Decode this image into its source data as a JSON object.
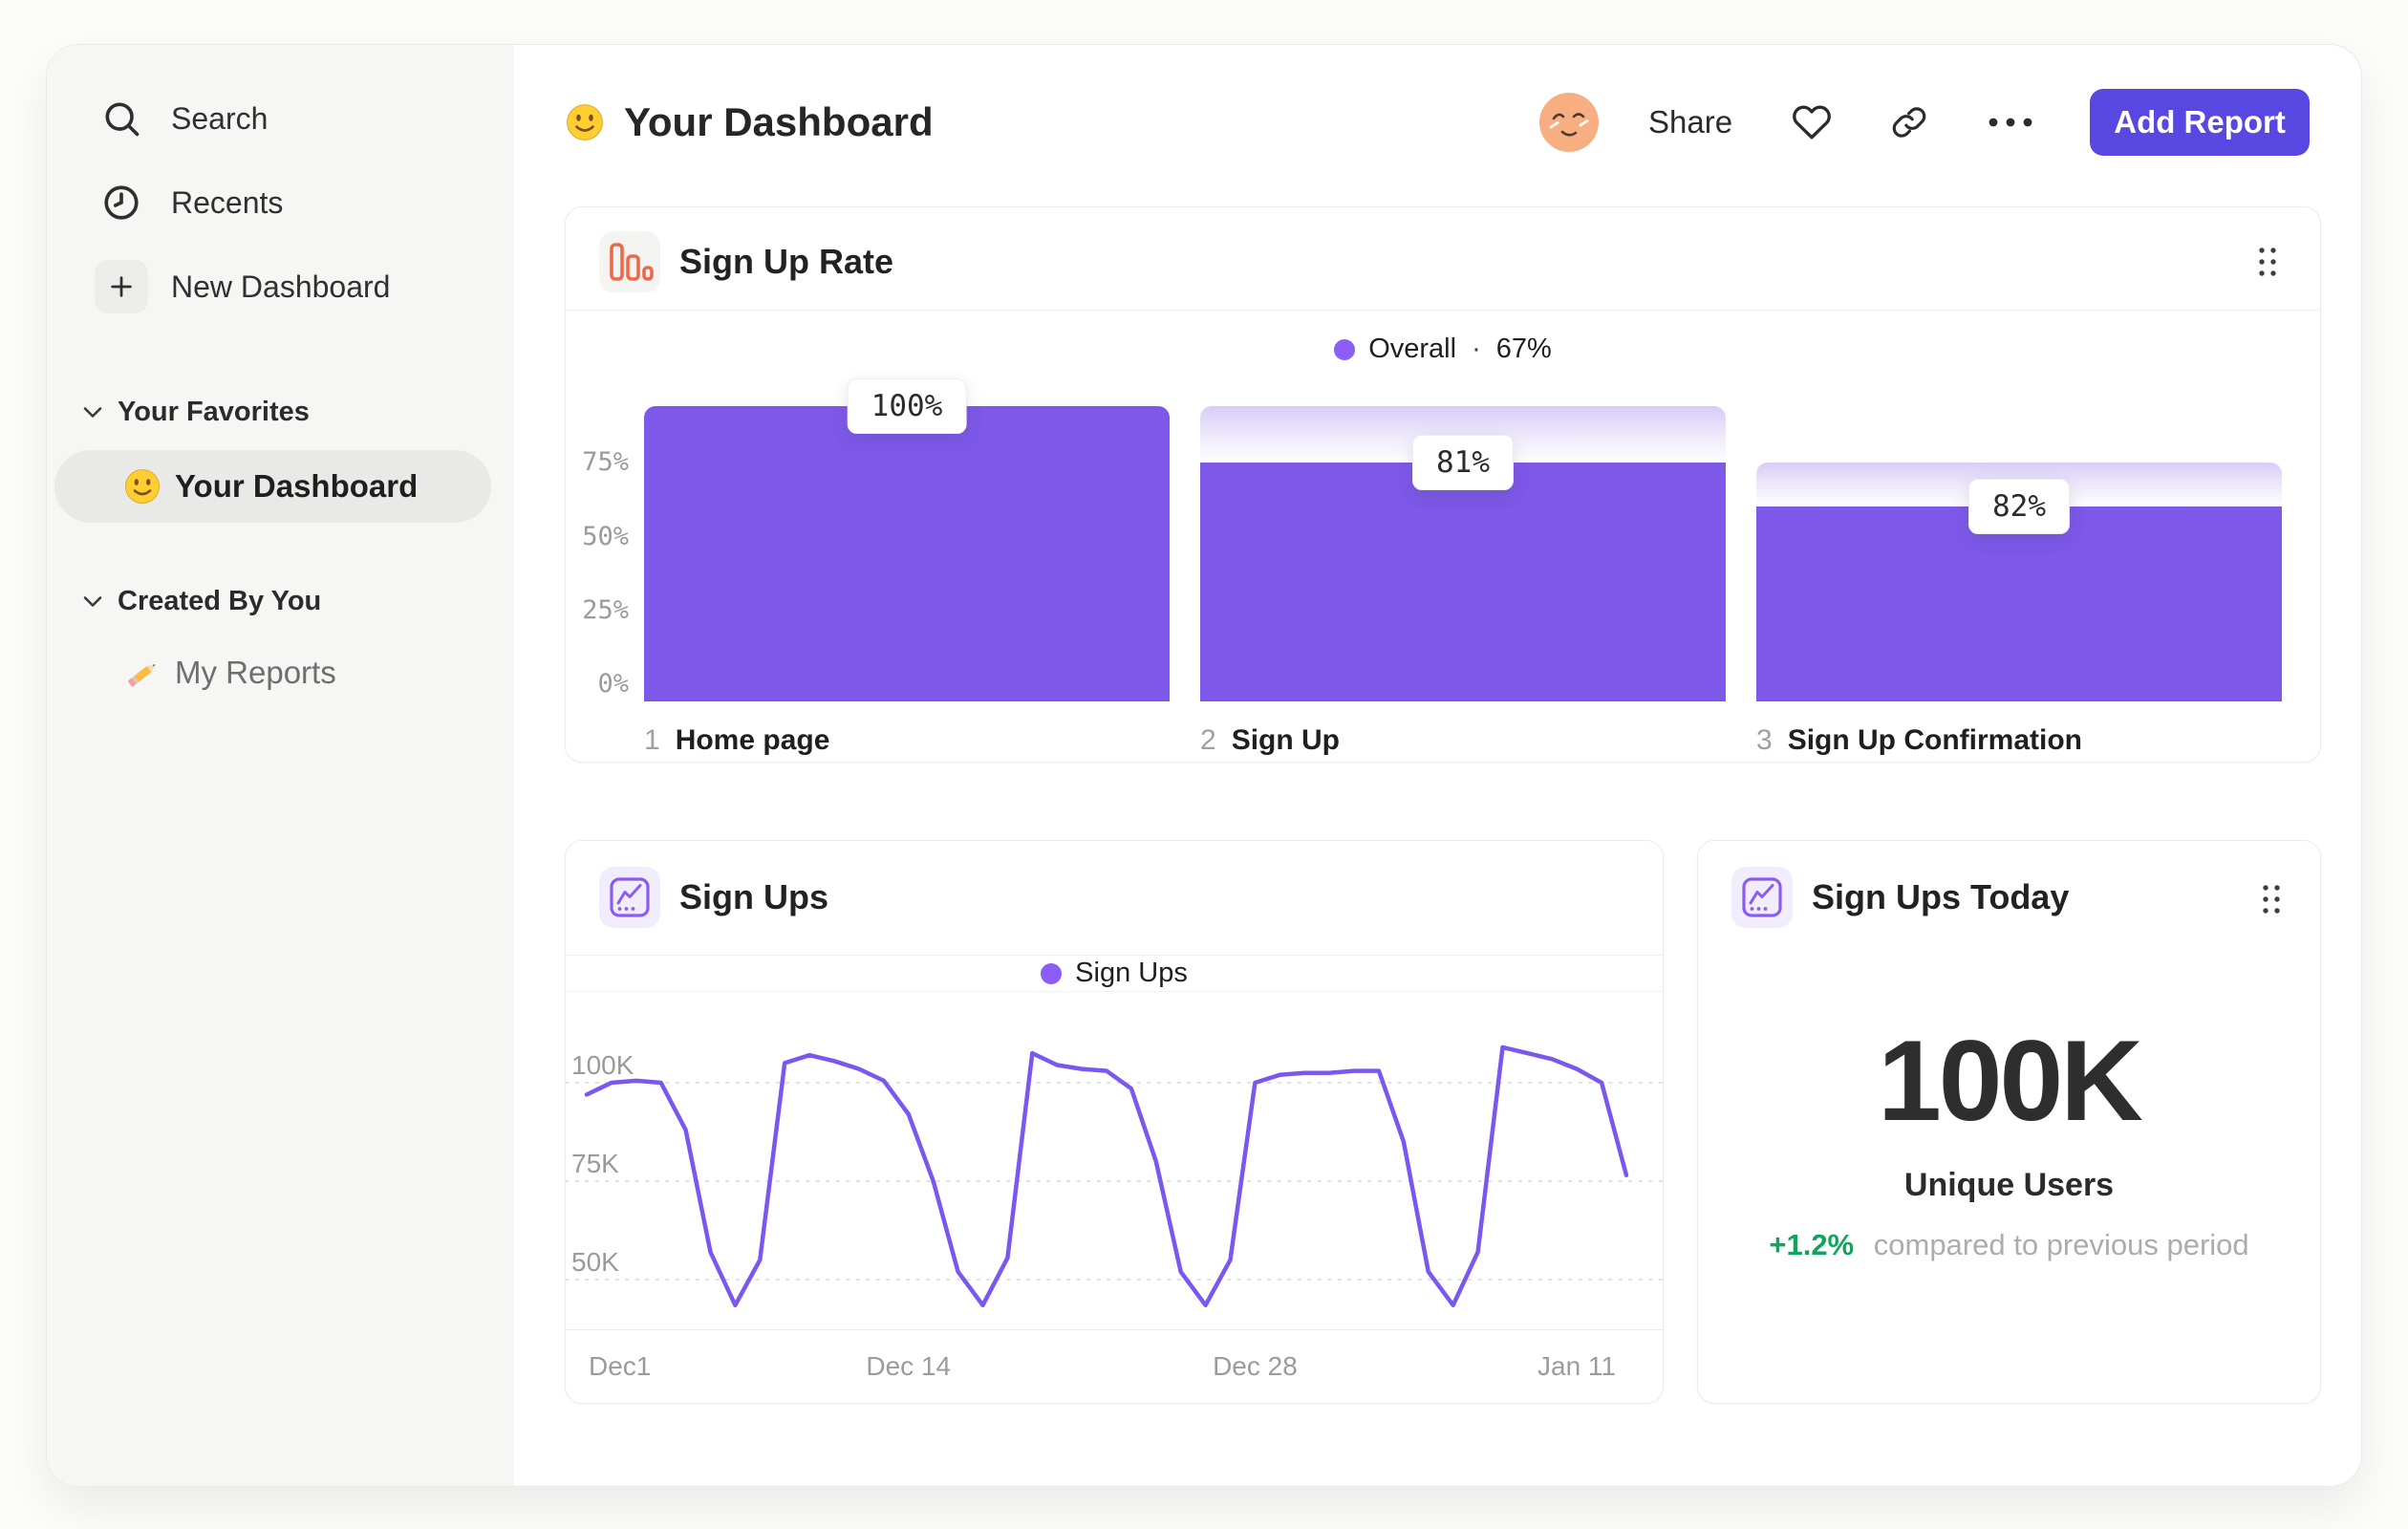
{
  "sidebar": {
    "nav": [
      {
        "label": "Search",
        "icon": "search-icon"
      },
      {
        "label": "Recents",
        "icon": "clock-icon"
      },
      {
        "label": "New Dashboard",
        "icon": "plus-icon"
      }
    ],
    "sections": [
      {
        "title": "Your Favorites",
        "items": [
          {
            "label": "Your Dashboard",
            "icon": "smiley-emoji",
            "selected": true
          }
        ]
      },
      {
        "title": "Created By You",
        "items": [
          {
            "label": "My Reports",
            "icon": "pencil-emoji",
            "selected": false
          }
        ]
      }
    ]
  },
  "header": {
    "title": "Your Dashboard",
    "title_icon": "smiley-emoji",
    "share": "Share",
    "add_report": "Add Report",
    "icons": [
      "avatar",
      "heart-icon",
      "link-icon",
      "more-icon"
    ]
  },
  "cards": {
    "funnel": {
      "title": "Sign Up Rate",
      "legend": {
        "label": "Overall",
        "separator": "·",
        "value": "67%"
      }
    },
    "line": {
      "title": "Sign Ups",
      "legend": {
        "label": "Sign Ups"
      }
    },
    "stat": {
      "title": "Sign Ups Today",
      "value": "100K",
      "subtitle": "Unique Users",
      "delta": "+1.2%",
      "delta_note": "compared to previous period"
    }
  },
  "chart_data": [
    {
      "type": "bar",
      "title": "Sign Up Rate",
      "legend": "Overall · 67%",
      "categories": [
        "Home page",
        "Sign Up",
        "Sign Up Confirmation"
      ],
      "step_indices": [
        "1",
        "2",
        "3"
      ],
      "step_conversion_labels": [
        "100%",
        "81%",
        "82%"
      ],
      "overall_pct": [
        100,
        81,
        66
      ],
      "window_pct": [
        100,
        100,
        81
      ],
      "y_ticks": [
        {
          "label": "75%",
          "value": 75
        },
        {
          "label": "50%",
          "value": 50
        },
        {
          "label": "25%",
          "value": 25
        },
        {
          "label": "0%",
          "value": 0
        }
      ],
      "ylim": [
        0,
        100
      ],
      "grid": false
    },
    {
      "type": "line",
      "title": "Sign Ups",
      "legend": "Sign Ups",
      "unit": "K",
      "x_start": "Dec 1",
      "x_ticks": [
        {
          "label": "Dec1",
          "index": 0
        },
        {
          "label": "Dec 14",
          "index": 13
        },
        {
          "label": "Dec 28",
          "index": 27
        },
        {
          "label": "Jan 11",
          "index": 41
        }
      ],
      "y_ticks": [
        {
          "label": "100K",
          "value": 100
        },
        {
          "label": "75K",
          "value": 75
        },
        {
          "label": "50K",
          "value": 50
        }
      ],
      "values": [
        97,
        100,
        100.5,
        100,
        88,
        57,
        43.5,
        55,
        105,
        107,
        105.5,
        103.5,
        100.5,
        92,
        75,
        52,
        43.5,
        55.5,
        107.5,
        104.5,
        103.5,
        103,
        98.5,
        80,
        52,
        43.5,
        55,
        100,
        102,
        102.5,
        102.5,
        103,
        103,
        85,
        52,
        43.5,
        57,
        109,
        107.5,
        106,
        103.5,
        100,
        76.5
      ],
      "ylim_visible": [
        40,
        112
      ],
      "grid": "dashed-horizontal"
    },
    {
      "type": "stat",
      "title": "Sign Ups Today",
      "value": "100K",
      "label": "Unique Users",
      "delta_pct": "+1.2%",
      "delta_note": "compared to previous period"
    }
  ],
  "colors": {
    "bar_purple": "#7D58E9",
    "line_purple": "#7A57EE",
    "legend_dot": "#8B5CF6",
    "button_purple": "#5847E1",
    "funnel_icon_orange": "#F0684A",
    "chart_icon_purple": "#8A5CF2",
    "delta_green": "#12A45C",
    "sidebar_bg": "#F6F6F5",
    "axis_gray": "#9B9B9B"
  }
}
